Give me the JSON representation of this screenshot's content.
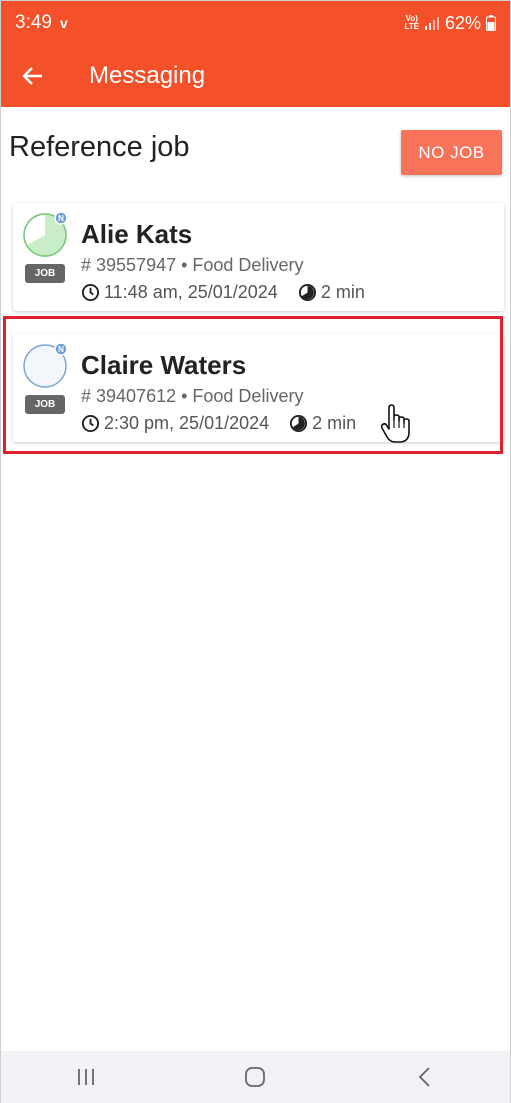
{
  "status_bar": {
    "time": "3:49",
    "carrier_mark": "v",
    "network": "Vo) LTE",
    "battery": "62%"
  },
  "app_bar": {
    "back_icon": "arrow-left-icon",
    "title": "Messaging"
  },
  "section": {
    "title": "Reference job",
    "no_job_button": "NO JOB"
  },
  "jobs": [
    {
      "name": "Alie Kats",
      "job_tag": "JOB",
      "avatar_badge": "N",
      "job_number": "# 39557947 • Food Delivery",
      "time": "11:48 am, 25/01/2024",
      "duration": "2 min",
      "progress": 0.65,
      "accent": "#7bc87b"
    },
    {
      "name": "Claire Waters",
      "job_tag": "JOB",
      "avatar_badge": "N",
      "job_number": "# 39407612 • Food Delivery",
      "time": "2:30 pm, 25/01/2024",
      "duration": "2 min",
      "progress": 0.0,
      "accent": "#7aa7d6"
    }
  ],
  "colors": {
    "brand": "#f4502a",
    "button": "#f7735a",
    "highlight": "#e0202c"
  },
  "nav": {
    "recents_icon": "recents-icon",
    "home_icon": "home-icon",
    "back_icon": "back-icon"
  }
}
